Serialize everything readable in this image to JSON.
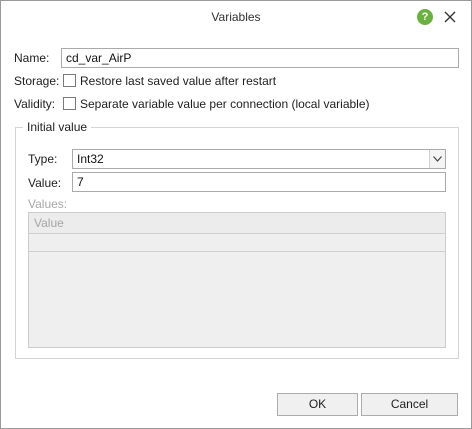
{
  "dialog": {
    "title": "Variables",
    "help_icon_glyph": "?",
    "help_color": "#6bb140"
  },
  "fields": {
    "name_label": "Name:",
    "name_value": "cd_var_AirP",
    "storage_label": "Storage:",
    "storage_checkbox_label": "Restore last saved value after restart",
    "storage_checked": false,
    "validity_label": "Validity:",
    "validity_checkbox_label": "Separate variable value per connection (local variable)",
    "validity_checked": false
  },
  "initial_value": {
    "group_title": "Initial value",
    "type_label": "Type:",
    "type_value": "Int32",
    "value_label": "Value:",
    "value_value": "7",
    "values_label": "Values:",
    "grid_column_header": "Value"
  },
  "buttons": {
    "ok_label": "OK",
    "cancel_label": "Cancel"
  }
}
